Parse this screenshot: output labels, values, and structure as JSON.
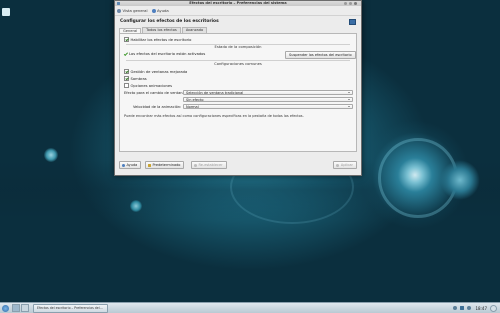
{
  "window": {
    "title": "Efectos del escritorio – Preferencias del sistema",
    "toolbar": {
      "overview": "Vista general",
      "help": "Ayuda"
    },
    "header": "Configurar los efectos de los escritorios",
    "tabs": [
      "General",
      "Todos los efectos",
      "Avanzado"
    ],
    "active_tab": "General",
    "general": {
      "enable_effects": "Habilitar los efectos de escritorio",
      "compositing_section": "Estado de la composición",
      "status_text": "Los efectos del escritorio están activados",
      "suspend_button": "Suspender los efectos del escritorio",
      "common_section": "Configuraciones comunes",
      "options": [
        {
          "label": "Gestión de ventanas mejorada",
          "checked": true
        },
        {
          "label": "Sombras",
          "checked": true
        },
        {
          "label": "Opciones animaciones",
          "checked": false
        }
      ],
      "window_switch_label": "Efecto para el cambio de ventana:",
      "window_switch_value": "Selección de ventana tradicional",
      "desktop_switch_label": "",
      "desktop_switch_value": "Sin efecto",
      "anim_speed_label": "Velocidad de la animación:",
      "anim_speed_value": "Normal",
      "note": "Puede encontrar más efectos así como configuraciones específicas en la pestaña de todos los efectos."
    },
    "buttons": {
      "help": "Ayuda",
      "defaults": "Predeterminado",
      "reset": "Re-establecer",
      "apply": "Aplicar"
    }
  },
  "taskbar": {
    "task_label": "Efectos del escritorio – Preferencias del...",
    "clock": "18:47"
  },
  "colors": {
    "check": "#3f9a2d",
    "wallpaper": "#1a6278"
  }
}
